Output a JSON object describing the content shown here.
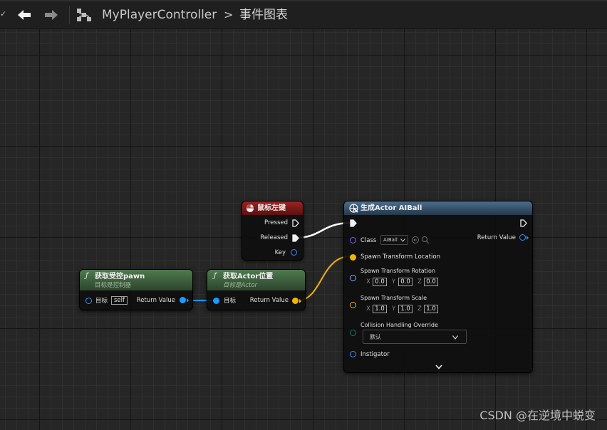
{
  "toolbar": {
    "graph_name": "MyPlayerController",
    "breadcrumb_separator": ">",
    "current_graph": "事件图表"
  },
  "nodes": {
    "mouse_left": {
      "title": "鼠标左键",
      "pins": {
        "pressed": "Pressed",
        "released": "Released",
        "key": "Key"
      },
      "header_color": "#8b1a1a"
    },
    "get_controlled_pawn": {
      "title": "获取受控pawn",
      "subtitle": "目标是控制器",
      "target_label": "目标",
      "target_value": "self",
      "return_label": "Return Value",
      "header_color": "#3f5f3f"
    },
    "get_actor_location": {
      "title": "获取Actor位置",
      "subtitle": "目标是Actor",
      "target_label": "目标",
      "return_label": "Return Value",
      "header_color": "#3f5f3f"
    },
    "spawn_actor": {
      "title": "生成Actor AIBall",
      "class_label": "Class",
      "class_value": "AIBall",
      "return_label": "Return Value",
      "location_label": "Spawn Transform Location",
      "rotation_label": "Spawn Transform Rotation",
      "rotation": {
        "x": "0.0",
        "y": "0.0",
        "z": "0.0"
      },
      "scale_label": "Spawn Transform Scale",
      "scale": {
        "x": "1.0",
        "y": "1.0",
        "z": "1.0"
      },
      "axis_labels": {
        "x": "X",
        "y": "Y",
        "z": "Z"
      },
      "collision_label": "Collision Handling Override",
      "collision_value": "默认",
      "instigator_label": "Instigator",
      "header_color": "#3a5a75"
    }
  },
  "watermark": "CSDN @在逆境中蜕变",
  "colors": {
    "exec_wire": "#ffffff",
    "object_wire": "#1a9bff",
    "vector_wire": "#f4b400"
  }
}
